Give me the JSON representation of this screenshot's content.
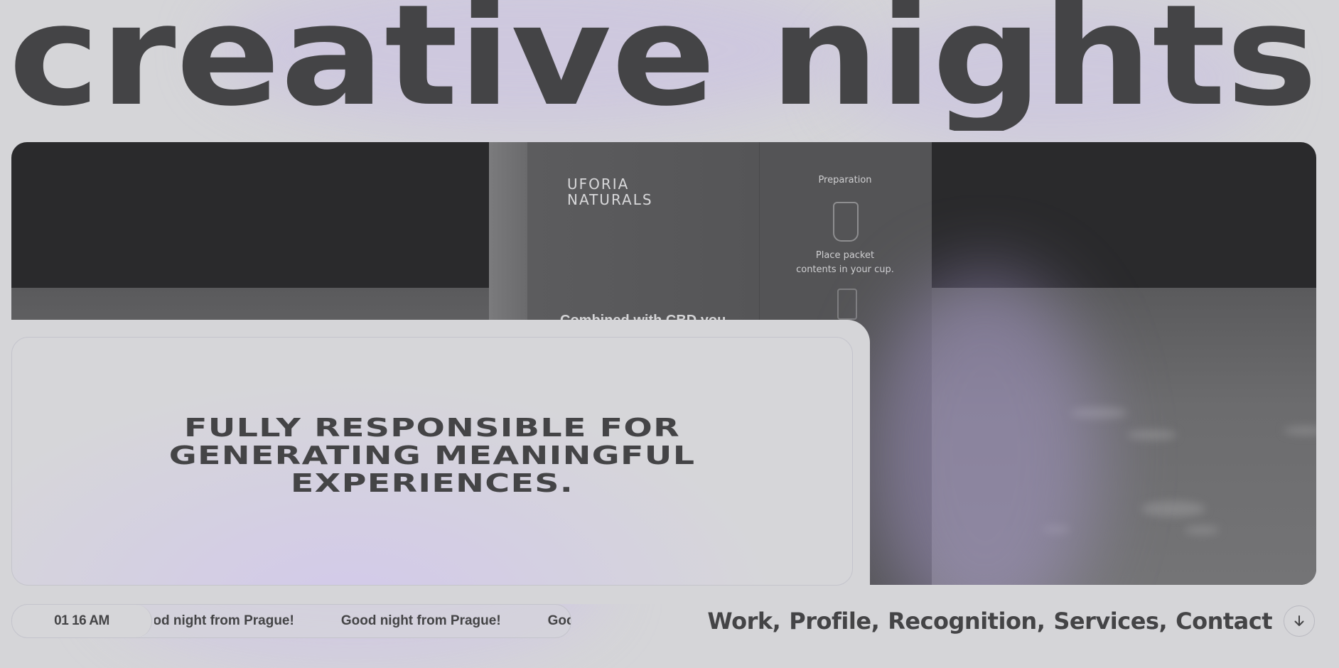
{
  "hero": {
    "title": "creative nights"
  },
  "media": {
    "brand_line1": "UFORIA",
    "brand_line2": "NATURALS",
    "preparation_label": "Preparation",
    "step1_line1": "Place packet",
    "step1_line2": "contents in your cup.",
    "heading_partial": "Combined with CBD you"
  },
  "tagline": {
    "line1": "FULLY RESPONSIBLE FOR",
    "line2": "GENERATING MEANINGFUL",
    "line3": "EXPERIENCES."
  },
  "ticker": {
    "time": "01 16 AM",
    "messages": [
      "Good night from Prague!",
      "Good night from Prague!",
      "Good night from Prague!"
    ]
  },
  "nav": {
    "items": [
      "Work",
      "Profile",
      "Recognition",
      "Services",
      "Contact"
    ]
  },
  "scroll_button": {
    "icon": "arrow-down-icon"
  },
  "colors": {
    "background": "#d5d5d8",
    "text": "#444446",
    "accent_glow": "#c8bee4"
  }
}
